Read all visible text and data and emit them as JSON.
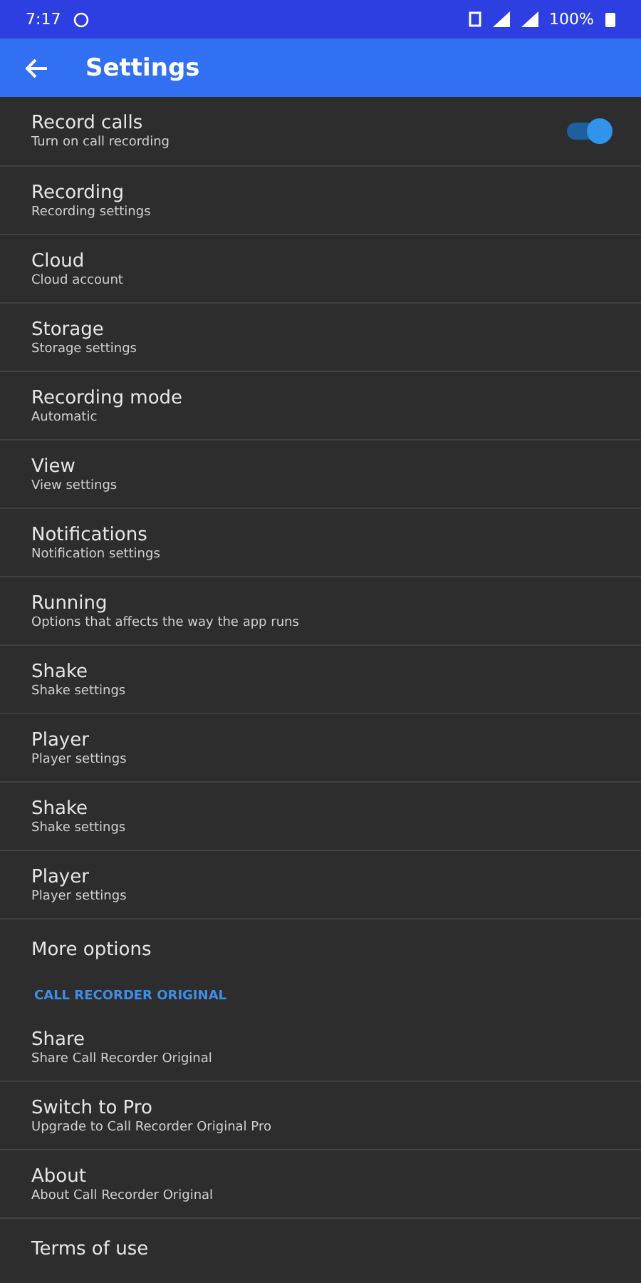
{
  "status_bar": {
    "time": "7:17",
    "battery": "100%"
  },
  "app_bar": {
    "title": "Settings"
  },
  "items": [
    {
      "kind": "toggle",
      "title": "Record calls",
      "summary": "Turn on call recording",
      "on": true
    },
    {
      "kind": "pref",
      "title": "Recording",
      "summary": "Recording settings"
    },
    {
      "kind": "pref",
      "title": "Cloud",
      "summary": "Cloud account"
    },
    {
      "kind": "pref",
      "title": "Storage",
      "summary": "Storage settings"
    },
    {
      "kind": "pref",
      "title": "Recording mode",
      "summary": "Automatic"
    },
    {
      "kind": "pref",
      "title": "View",
      "summary": "View settings"
    },
    {
      "kind": "pref",
      "title": "Notifications",
      "summary": "Notification settings"
    },
    {
      "kind": "pref",
      "title": "Running",
      "summary": "Options that affects the way the app runs"
    },
    {
      "kind": "pref",
      "title": "Shake",
      "summary": "Shake settings"
    },
    {
      "kind": "pref",
      "title": "Player",
      "summary": "Player settings"
    },
    {
      "kind": "pref",
      "title": "Shake",
      "summary": "Shake settings"
    },
    {
      "kind": "pref",
      "title": "Player",
      "summary": "Player settings"
    },
    {
      "kind": "plain",
      "title": "More options"
    },
    {
      "kind": "header",
      "title": "CALL RECORDER ORIGINAL"
    },
    {
      "kind": "pref",
      "title": "Share",
      "summary": "Share Call Recorder Original"
    },
    {
      "kind": "pref",
      "title": "Switch to Pro",
      "summary": "Upgrade to Call Recorder Original Pro"
    },
    {
      "kind": "pref",
      "title": "About",
      "summary": "About Call Recorder Original"
    },
    {
      "kind": "plain",
      "title": "Terms of use"
    }
  ]
}
